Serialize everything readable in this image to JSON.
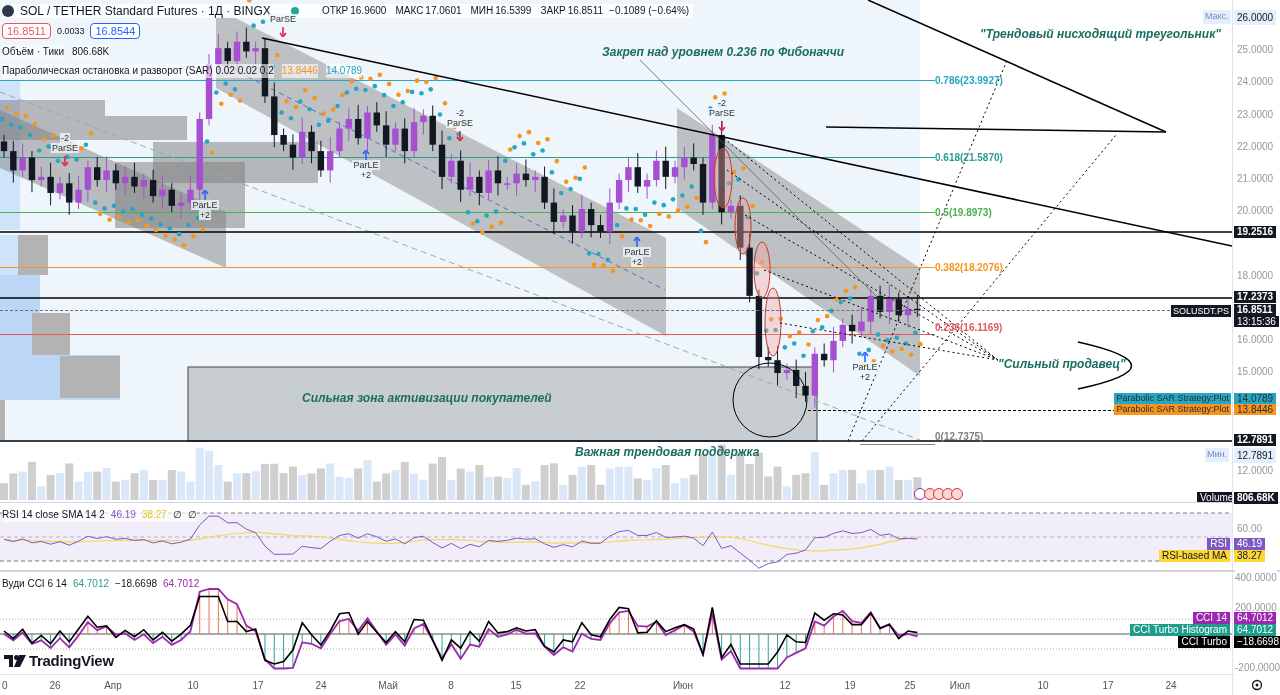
{
  "legend": {
    "symbol": "SOL / TETHER Standard Futures · 1Д · BINGX",
    "ohlc": [
      {
        "label": "ОТКР",
        "value": "16.9600"
      },
      {
        "label": "МАКС",
        "value": "17.0601"
      },
      {
        "label": "МИН",
        "value": "16.5399"
      },
      {
        "label": "ЗАКР",
        "value": "16.8511"
      }
    ],
    "change": "−0.1089 (−0.64%)",
    "bid": "16.8511",
    "spread": "0.0033",
    "ask": "16.8544"
  },
  "indicators": [
    {
      "name": "Объём · Тики",
      "values": [
        {
          "text": "806.68K"
        }
      ]
    },
    {
      "name": "Параболическая остановка и разворот (SAR) 0.02 0.02 0.2",
      "values": [
        {
          "text": "13.8446",
          "color": "#f7941d"
        },
        {
          "text": "14.0789",
          "color": "#26a6c2"
        }
      ]
    }
  ],
  "price_axis": {
    "max_label": "Макс.",
    "max_value": "26.0000",
    "ticks": [
      "25.0000",
      "24.0000",
      "23.0000",
      "22.0000",
      "21.0000",
      "20.0000",
      "18.0000",
      "16.0000",
      "15.0000",
      "12.0000"
    ],
    "min_label": "Мин.",
    "min_value": "12.7891"
  },
  "price_tags": [
    {
      "kind": "line",
      "value": "19.2516"
    },
    {
      "kind": "line",
      "value": "17.2373"
    },
    {
      "kind": "symbol",
      "name": "SOLUSDT.PS",
      "value": "16.8511",
      "countdown": "13:15:36"
    },
    {
      "kind": "plot",
      "name": "Parabolic SAR Strategy:Plot",
      "value": "14.0789",
      "color": "#26a6c2"
    },
    {
      "kind": "plot",
      "name": "Parabolic SAR Strategy:Plot",
      "value": "13.8446",
      "color": "#f7941d"
    },
    {
      "kind": "line",
      "value": "12.7891"
    }
  ],
  "volume_tag": {
    "name": "Volume",
    "value": "806.68K"
  },
  "fib_levels": [
    {
      "label": "0.786(23.9927)",
      "color": "#26a6c2"
    },
    {
      "label": "0.618(21.5870)",
      "color": "#2a9d8f"
    },
    {
      "label": "0.5(19.8973)",
      "color": "#4caf50"
    },
    {
      "label": "0.382(18.2076)",
      "color": "#f7941d"
    },
    {
      "label": "0.236(16.1169)",
      "color": "#e05a5a"
    },
    {
      "label": "0(12.7375)",
      "color": "#808080"
    }
  ],
  "signals": [
    {
      "kind": "short",
      "lines": [
        "ParSE"
      ]
    },
    {
      "kind": "short",
      "lines": [
        "-2",
        "ParSE"
      ]
    },
    {
      "kind": "short",
      "lines": [
        "-2",
        "ParSE"
      ]
    },
    {
      "kind": "short",
      "lines": [
        "-2",
        "ParSE"
      ]
    },
    {
      "kind": "long",
      "lines": [
        "ParLE",
        "+2"
      ]
    },
    {
      "kind": "long",
      "lines": [
        "ParLE",
        "+2"
      ]
    },
    {
      "kind": "long",
      "lines": [
        "ParLE",
        "+2"
      ]
    },
    {
      "kind": "long",
      "lines": [
        "ParLE",
        "+2"
      ]
    }
  ],
  "annotations": [
    "Закреп над уровнем 0.236 по Фибоначчи",
    "\"Трендовый нисходящий треугольник\"",
    "\"Сильный продавец\"",
    "Сильная зона активизации покупателей",
    "Важная трендовая поддержка"
  ],
  "rsi": {
    "legend": "RSI 14 close SMA 14 2",
    "values": [
      {
        "text": "46.19",
        "color": "#7e57c2"
      },
      {
        "text": "38.27",
        "color": "#e6c619"
      },
      {
        "text": "∅"
      },
      {
        "text": "∅"
      }
    ],
    "ticks": [
      "60.00"
    ],
    "tags": [
      {
        "name": "RSI",
        "value": "46.19",
        "color": "#7e57c2"
      },
      {
        "name": "RSI-based MA",
        "value": "38.27",
        "color": "#fdd835"
      }
    ]
  },
  "cci": {
    "legend": "Вуди CCI 6 14",
    "values": [
      {
        "text": "64.7012",
        "color": "#2a9d8f"
      },
      {
        "text": "−18.6698",
        "color": "#131722"
      },
      {
        "text": "64.7012",
        "color": "#9c27b0"
      }
    ],
    "ticks": [
      "400.0000",
      "200.0000",
      "-200.0000"
    ],
    "tags": [
      {
        "name": "CCI 14",
        "value": "64.7012",
        "color": "#9c27b0"
      },
      {
        "name": "CCI Turbo Histogram",
        "value": "64.7012",
        "color": "#1e9e8a"
      },
      {
        "name": "CCI Turbo",
        "value": "−18.6698",
        "color": "#000000"
      }
    ]
  },
  "brand": "TradingView",
  "time_axis": [
    "0",
    "26",
    "Апр",
    "10",
    "17",
    "24",
    "Май",
    "8",
    "15",
    "22",
    "Июн",
    "12",
    "19",
    "25",
    "Июл",
    "10",
    "17",
    "24"
  ]
}
